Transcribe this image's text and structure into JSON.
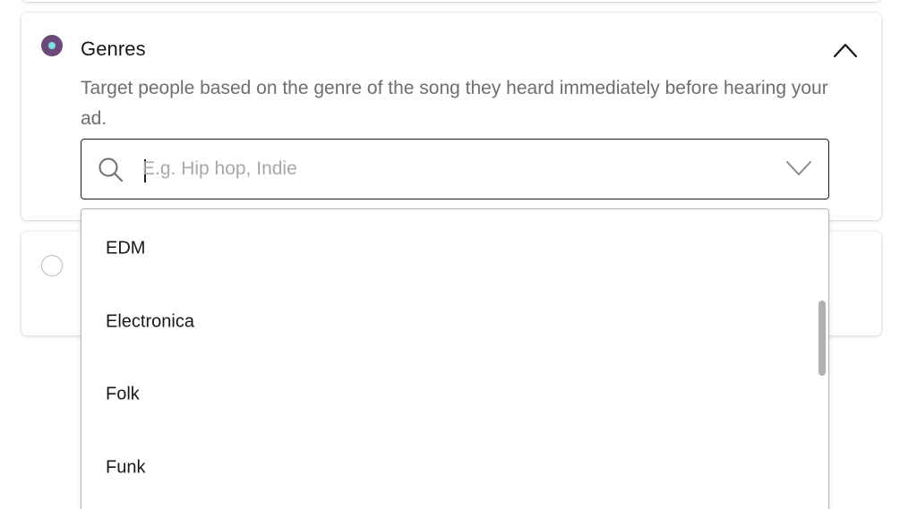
{
  "genres_section": {
    "title": "Genres",
    "description": "Target people based on the genre of the song they heard immediately before hearing your ad.",
    "selected": true,
    "expanded": true,
    "collapse_icon": "chevron-up-icon"
  },
  "search": {
    "placeholder": "E.g. Hip hop, Indie",
    "value": "",
    "icon": "search-icon",
    "dropdown_icon": "chevron-down-icon"
  },
  "dropdown": {
    "options": [
      {
        "label": "EDM"
      },
      {
        "label": "Electronica"
      },
      {
        "label": "Folk"
      },
      {
        "label": "Funk"
      }
    ]
  },
  "next_section": {
    "selected": false
  },
  "colors": {
    "radio_selected": "#6b4a7b",
    "radio_dot": "#7fe0d8",
    "text_primary": "#181818",
    "text_secondary": "#6e6e6e",
    "placeholder": "#a8a8a8"
  }
}
